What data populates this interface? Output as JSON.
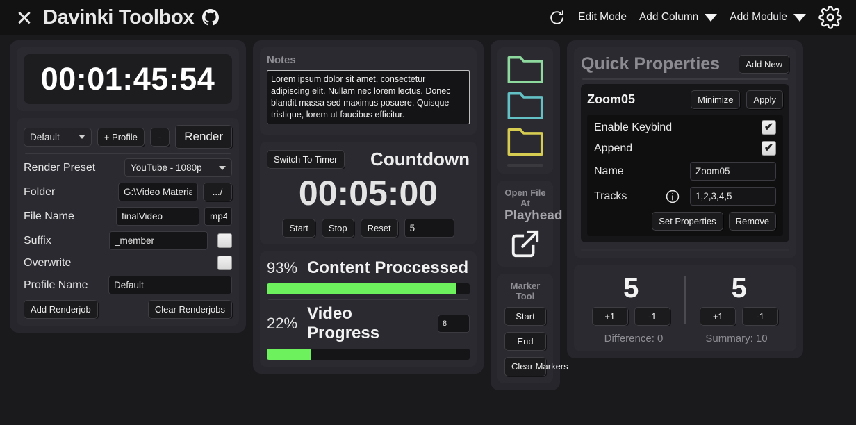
{
  "titlebar": {
    "close_icon": "close-icon",
    "title": "Davinki Toolbox",
    "github_icon": "github-icon",
    "refresh_icon": "refresh-icon",
    "edit_mode": "Edit Mode",
    "add_column": "Add Column",
    "add_module": "Add Module",
    "settings_icon": "gear-icon"
  },
  "render": {
    "timecode": "00:01:45:54",
    "profile_select": "Default",
    "add_profile": "+ Profile",
    "remove_profile": "-",
    "render_button": "Render",
    "preset_label": "Render Preset",
    "preset_value": "YouTube - 1080p",
    "folder_label": "Folder",
    "folder_value": "G:\\Video Material\\",
    "folder_browse": ".../",
    "filename_label": "File Name",
    "filename_value": "finalVideo",
    "extension_value": "mp4",
    "suffix_label": "Suffix",
    "suffix_value": "_member",
    "suffix_checked": false,
    "overwrite_label": "Overwrite",
    "overwrite_checked": false,
    "profilename_label": "Profile Name",
    "profilename_value": "Default",
    "add_renderjob": "Add Renderjob",
    "clear_renderjobs": "Clear Renderjobs"
  },
  "notes": {
    "title": "Notes",
    "text": "Lorem ipsum dolor sit amet, consectetur adipiscing elit. Nullam nec lorem lectus. Donec blandit massa sed maximus posuere. Quisque tristique, lorem ut faucibus efficitur."
  },
  "countdown": {
    "switch_button": "Switch To Timer",
    "title": "Countdown",
    "time": "00:05:00",
    "start": "Start",
    "stop": "Stop",
    "reset": "Reset",
    "minutes_value": "5"
  },
  "progress": {
    "bars": [
      {
        "percent_label": "93%",
        "label": "Content Proccessed",
        "value": 93
      },
      {
        "percent_label": "22%",
        "label": "Video Progress",
        "value": 22,
        "input_value": "8"
      }
    ]
  },
  "filetool": {
    "folders": [
      {
        "name": "folder-icon-green",
        "color": "#8ed99e"
      },
      {
        "name": "folder-icon-teal",
        "color": "#63c0c4"
      },
      {
        "name": "folder-icon-yellow",
        "color": "#d6cc52"
      }
    ],
    "open_file_line1": "Open File At",
    "open_file_line2": "Playhead",
    "open_icon": "external-link-icon",
    "marker_title": "Marker Tool",
    "marker_start": "Start",
    "marker_end": "End",
    "marker_clear": "Clear Markers"
  },
  "quick_properties": {
    "title": "Quick Properties",
    "add_new": "Add New",
    "item": {
      "name": "Zoom05",
      "minimize": "Minimize",
      "apply": "Apply",
      "enable_keybind_label": "Enable Keybind",
      "enable_keybind_checked": true,
      "append_label": "Append",
      "append_checked": true,
      "name_label": "Name",
      "name_value": "Zoom05",
      "tracks_label": "Tracks",
      "tracks_info_icon": "info-icon",
      "tracks_value": "1,2,3,4,5",
      "set_properties": "Set Properties",
      "remove": "Remove"
    }
  },
  "counters": {
    "left_value": "5",
    "right_value": "5",
    "plus": "+1",
    "minus": "-1",
    "difference": "Difference: 0",
    "summary": "Summary: 10"
  },
  "colors": {
    "progress_green": "#6df25e",
    "background": "#1a1a1c",
    "column": "#26262c",
    "module": "#2a2a30"
  }
}
